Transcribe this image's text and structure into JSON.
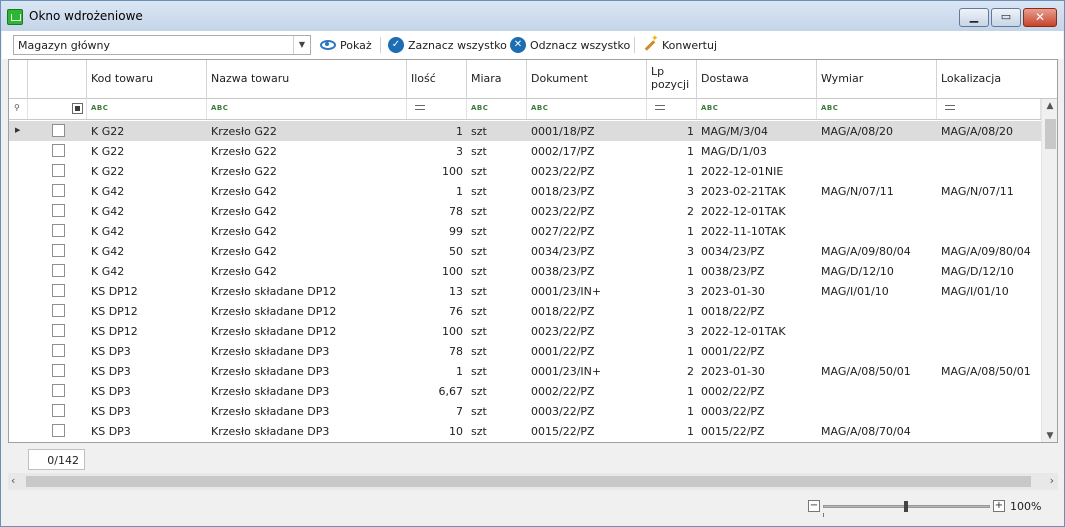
{
  "window": {
    "title": "Okno wdrożeniowe"
  },
  "toolbar": {
    "warehouse": "Magazyn główny",
    "show_label": "Pokaż",
    "select_all_label": "Zaznacz wszystko",
    "deselect_all_label": "Odznacz wszystko",
    "convert_label": "Konwertuj"
  },
  "grid": {
    "columns": {
      "kod": "Kod towaru",
      "nazwa": "Nazwa towaru",
      "ilosc": "Ilość",
      "miara": "Miara",
      "dokument": "Dokument",
      "lp_line1": "Lp",
      "lp_line2": "pozycji",
      "dostawa": "Dostawa",
      "wymiar": "Wymiar",
      "lokalizacja": "Lokalizacja"
    },
    "filter_abc": "ABC",
    "rows": [
      {
        "kod": "K G22",
        "nazwa": "Krzesło G22",
        "ilosc": "1",
        "miara": "szt",
        "dokument": "0001/18/PZ",
        "lp": "1",
        "dostawa": "MAG/M/3/04",
        "wymiar": "MAG/A/08/20",
        "lokalizacja": "MAG/A/08/20"
      },
      {
        "kod": "K G22",
        "nazwa": "Krzesło G22",
        "ilosc": "3",
        "miara": "szt",
        "dokument": "0002/17/PZ",
        "lp": "1",
        "dostawa": "MAG/D/1/03",
        "wymiar": "",
        "lokalizacja": ""
      },
      {
        "kod": "K G22",
        "nazwa": "Krzesło G22",
        "ilosc": "100",
        "miara": "szt",
        "dokument": "0023/22/PZ",
        "lp": "1",
        "dostawa": "2022-12-01NIE",
        "wymiar": "",
        "lokalizacja": ""
      },
      {
        "kod": "K G42",
        "nazwa": "Krzesło G42",
        "ilosc": "1",
        "miara": "szt",
        "dokument": "0018/23/PZ",
        "lp": "3",
        "dostawa": "2023-02-21TAK",
        "wymiar": "MAG/N/07/11",
        "lokalizacja": "MAG/N/07/11"
      },
      {
        "kod": "K G42",
        "nazwa": "Krzesło G42",
        "ilosc": "78",
        "miara": "szt",
        "dokument": "0023/22/PZ",
        "lp": "2",
        "dostawa": "2022-12-01TAK",
        "wymiar": "",
        "lokalizacja": ""
      },
      {
        "kod": "K G42",
        "nazwa": "Krzesło G42",
        "ilosc": "99",
        "miara": "szt",
        "dokument": "0027/22/PZ",
        "lp": "1",
        "dostawa": "2022-11-10TAK",
        "wymiar": "",
        "lokalizacja": ""
      },
      {
        "kod": "K G42",
        "nazwa": "Krzesło G42",
        "ilosc": "50",
        "miara": "szt",
        "dokument": "0034/23/PZ",
        "lp": "3",
        "dostawa": "0034/23/PZ",
        "wymiar": "MAG/A/09/80/04",
        "lokalizacja": "MAG/A/09/80/04"
      },
      {
        "kod": "K G42",
        "nazwa": "Krzesło G42",
        "ilosc": "100",
        "miara": "szt",
        "dokument": "0038/23/PZ",
        "lp": "1",
        "dostawa": "0038/23/PZ",
        "wymiar": "MAG/D/12/10",
        "lokalizacja": "MAG/D/12/10"
      },
      {
        "kod": "KS DP12",
        "nazwa": "Krzesło składane DP12",
        "ilosc": "13",
        "miara": "szt",
        "dokument": "0001/23/IN+",
        "lp": "3",
        "dostawa": "2023-01-30",
        "wymiar": "MAG/I/01/10",
        "lokalizacja": "MAG/I/01/10"
      },
      {
        "kod": "KS DP12",
        "nazwa": "Krzesło składane DP12",
        "ilosc": "76",
        "miara": "szt",
        "dokument": "0018/22/PZ",
        "lp": "1",
        "dostawa": "0018/22/PZ",
        "wymiar": "",
        "lokalizacja": ""
      },
      {
        "kod": "KS DP12",
        "nazwa": "Krzesło składane DP12",
        "ilosc": "100",
        "miara": "szt",
        "dokument": "0023/22/PZ",
        "lp": "3",
        "dostawa": "2022-12-01TAK",
        "wymiar": "",
        "lokalizacja": ""
      },
      {
        "kod": "KS DP3",
        "nazwa": "Krzesło składane DP3",
        "ilosc": "78",
        "miara": "szt",
        "dokument": "0001/22/PZ",
        "lp": "1",
        "dostawa": "0001/22/PZ",
        "wymiar": "",
        "lokalizacja": ""
      },
      {
        "kod": "KS DP3",
        "nazwa": "Krzesło składane DP3",
        "ilosc": "1",
        "miara": "szt",
        "dokument": "0001/23/IN+",
        "lp": "2",
        "dostawa": "2023-01-30",
        "wymiar": "MAG/A/08/50/01",
        "lokalizacja": "MAG/A/08/50/01"
      },
      {
        "kod": "KS DP3",
        "nazwa": "Krzesło składane DP3",
        "ilosc": "6,67",
        "miara": "szt",
        "dokument": "0002/22/PZ",
        "lp": "1",
        "dostawa": "0002/22/PZ",
        "wymiar": "",
        "lokalizacja": ""
      },
      {
        "kod": "KS DP3",
        "nazwa": "Krzesło składane DP3",
        "ilosc": "7",
        "miara": "szt",
        "dokument": "0003/22/PZ",
        "lp": "1",
        "dostawa": "0003/22/PZ",
        "wymiar": "",
        "lokalizacja": ""
      },
      {
        "kod": "KS DP3",
        "nazwa": "Krzesło składane DP3",
        "ilosc": "10",
        "miara": "szt",
        "dokument": "0015/22/PZ",
        "lp": "1",
        "dostawa": "0015/22/PZ",
        "wymiar": "MAG/A/08/70/04",
        "lokalizacja": ""
      }
    ],
    "selected_row": 0
  },
  "footer": {
    "count": "0/142"
  },
  "status": {
    "zoom": "100%",
    "zoom_level_percent": 100
  },
  "icons": {
    "window": "basket-icon",
    "show": "eye-icon",
    "select_all": "check-circle-icon",
    "deselect_all": "x-circle-icon",
    "convert": "magic-wand-icon"
  },
  "colors": {
    "accent": "#1d6db5",
    "selected_row": "#dcdcdc",
    "title_bar": "#c4d4e8"
  }
}
